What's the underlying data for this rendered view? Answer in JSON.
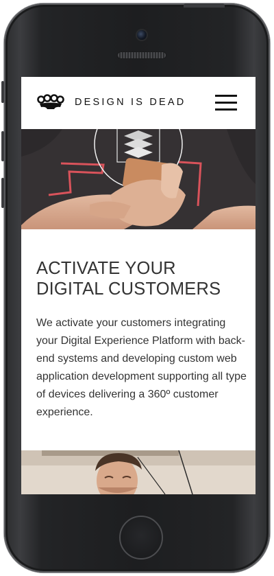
{
  "header": {
    "brand": "DESIGN IS DEAD",
    "logo_icon": "brass-knuckles-icon",
    "menu_icon": "hamburger-menu-icon"
  },
  "hero": {
    "image": "person-holding-smartphone-photo"
  },
  "main": {
    "headline_line1": "ACTIVATE YOUR",
    "headline_line2": "DIGITAL CUSTOMERS",
    "body": "We activate your customers integrating your Digital Experience Platform with back-end systems and developing custom web application development supporting all type of devices delivering a 360º customer experience."
  },
  "footer_image": {
    "image": "man-at-desk-photo"
  },
  "colors": {
    "text": "#333333",
    "brand_text": "#111111",
    "phone_body": "#1d1e20"
  }
}
